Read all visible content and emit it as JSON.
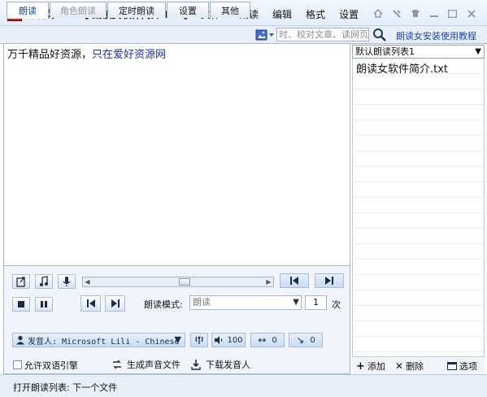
{
  "app": {
    "name": "朗读女",
    "document_title": "[ 朗读女软件简介.txt ]"
  },
  "menu": [
    "文件*",
    "朗读",
    "编辑",
    "格式",
    "设置"
  ],
  "tabs": [
    {
      "label": "朗读",
      "state": "active"
    },
    {
      "label": "角色朗读",
      "state": "disabled"
    },
    {
      "label": "定时朗读",
      "state": "normal"
    },
    {
      "label": "设置",
      "state": "normal"
    },
    {
      "label": "其他",
      "state": "normal"
    }
  ],
  "search": {
    "placeholder": "时、校对文章、读网页时"
  },
  "help_link": "朗读女安装使用教程",
  "editor": {
    "text_plain": "万千精品好资源，",
    "text_highlight": "只在爱好资源网"
  },
  "playback": {
    "mode_label": "朗读模式:",
    "mode_value": "朗读",
    "repeat_count": "1",
    "repeat_unit": "次",
    "voice": "发音人: Microsoft Lili - Chinese",
    "volume": "100",
    "speed": "0",
    "pitch": "0"
  },
  "options": {
    "bilingual_label": "允许双语引擎",
    "generate_audio_label": "生成声音文件",
    "download_voice_label": "下载发音人"
  },
  "playlist": {
    "name": "默认朗读列表1",
    "items": [
      "朗读女软件简介.txt"
    ],
    "add_label": "添加",
    "delete_label": "删除",
    "options_label": "选项"
  },
  "status": "打开朗读列表: 下一个文件",
  "colors": {
    "accent_blue": "#1044b5",
    "highlight_text": "#1b33a8",
    "logo_red": "#e21c12"
  }
}
